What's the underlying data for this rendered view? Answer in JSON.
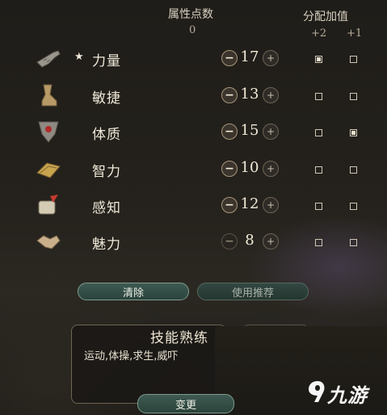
{
  "header": {
    "points_label": "属性点数",
    "points_value": "0",
    "allocate_label": "分配加值",
    "plus2_label": "+2",
    "plus1_label": "+1"
  },
  "attributes": [
    {
      "name": "力量",
      "value": "17",
      "starred": true,
      "plus2": true,
      "plus1": false,
      "icon": "gauntlet-icon",
      "minus_enabled": true
    },
    {
      "name": "敏捷",
      "value": "13",
      "starred": false,
      "plus2": false,
      "plus1": false,
      "icon": "boot-icon",
      "minus_enabled": true
    },
    {
      "name": "体质",
      "value": "15",
      "starred": false,
      "plus2": false,
      "plus1": true,
      "icon": "heart-shield-icon",
      "minus_enabled": true
    },
    {
      "name": "智力",
      "value": "10",
      "starred": false,
      "plus2": false,
      "plus1": false,
      "icon": "book-icon",
      "minus_enabled": true
    },
    {
      "name": "感知",
      "value": "12",
      "starred": false,
      "plus2": false,
      "plus1": false,
      "icon": "quill-scroll-icon",
      "minus_enabled": true
    },
    {
      "name": "魅力",
      "value": "8",
      "starred": false,
      "plus2": false,
      "plus1": false,
      "icon": "handshake-icon",
      "minus_enabled": false
    }
  ],
  "star_glyph": "★",
  "minus_glyph": "−",
  "plus_glyph": "+",
  "buttons": {
    "clear": "清除",
    "use_recommended": "使用推荐",
    "change": "变更"
  },
  "skills": {
    "title": "技能熟练",
    "list": "运动,体操,求生,威吓"
  },
  "watermark": {
    "text": "九游"
  },
  "colors": {
    "accent_teal": "#3d5a52",
    "text": "#efe8d8"
  }
}
